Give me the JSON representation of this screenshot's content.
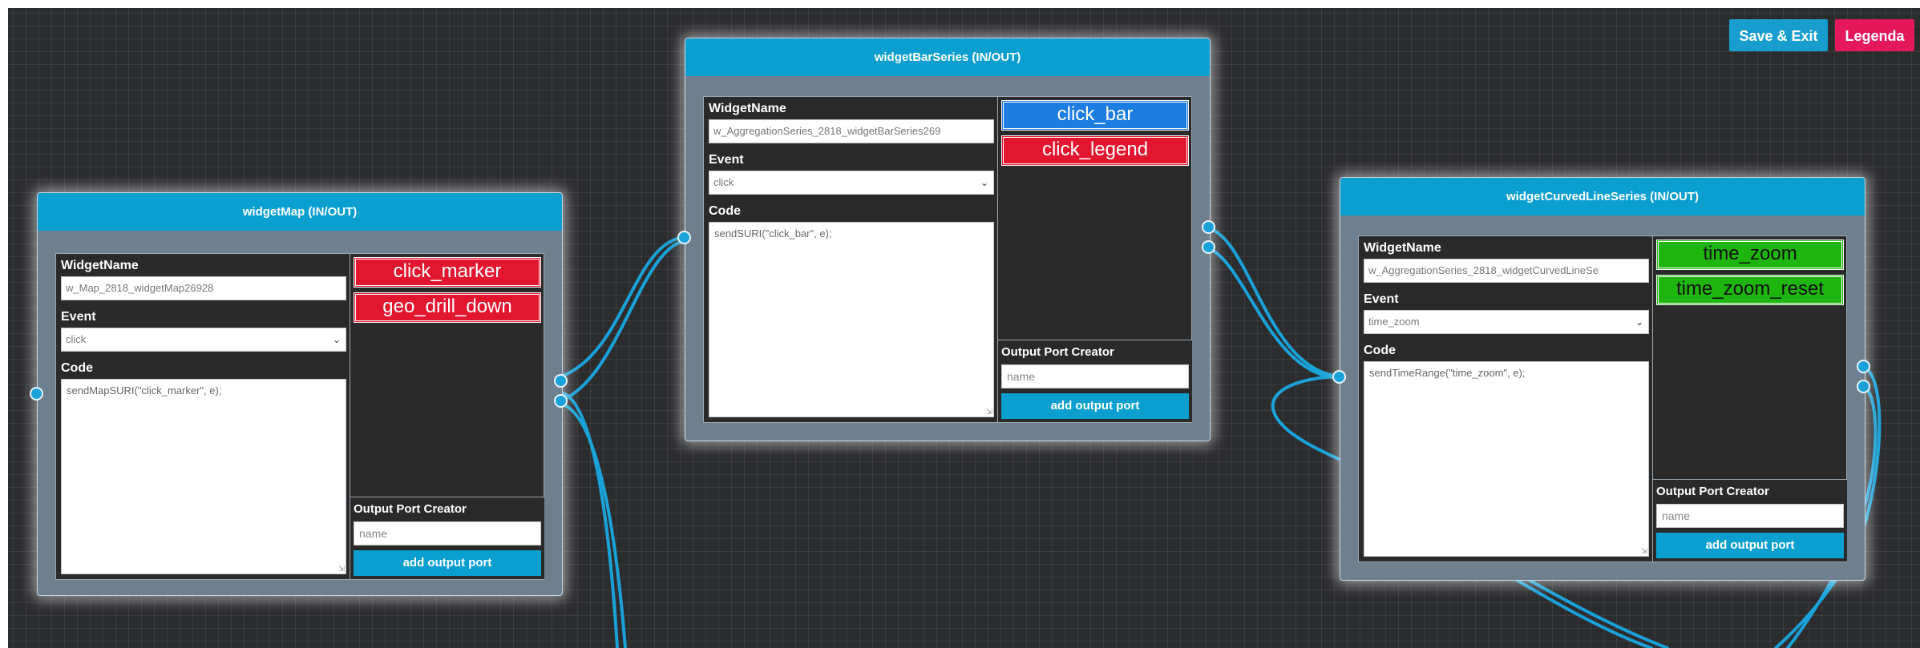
{
  "toolbar": {
    "save_exit": "Save & Exit",
    "legend": "Legenda"
  },
  "colors": {
    "accent": "#0b9fcf",
    "danger": "#e4185a",
    "wire": "#1aa2d8",
    "port_red": "#e2162e",
    "port_blue": "#1d7de0",
    "port_green": "#1fb50f"
  },
  "nodes": [
    {
      "title": "widgetMap (IN/OUT)",
      "widget_name_label": "WidgetName",
      "widget_name_value": "w_Map_2818_widgetMap26928",
      "event_label": "Event",
      "event_value": "click",
      "code_label": "Code",
      "code_value": "sendMapSURI(\"click_marker\", e);",
      "ports": [
        "click_marker",
        "geo_drill_down"
      ],
      "creator_title": "Output Port Creator",
      "creator_placeholder": "name",
      "add_port_label": "add output port"
    },
    {
      "title": "widgetBarSeries (IN/OUT)",
      "widget_name_label": "WidgetName",
      "widget_name_value": "w_AggregationSeries_2818_widgetBarSeries269",
      "event_label": "Event",
      "event_value": "click",
      "code_label": "Code",
      "code_value": "sendSURI(\"click_bar\", e);",
      "ports": [
        "click_bar",
        "click_legend"
      ],
      "creator_title": "Output Port Creator",
      "creator_placeholder": "name",
      "add_port_label": "add output port"
    },
    {
      "title": "widgetCurvedLineSeries (IN/OUT)",
      "widget_name_label": "WidgetName",
      "widget_name_value": "w_AggregationSeries_2818_widgetCurvedLineSe",
      "event_label": "Event",
      "event_value": "time_zoom",
      "code_label": "Code",
      "code_value": "sendTimeRange(\"time_zoom\", e);",
      "ports": [
        "time_zoom",
        "time_zoom_reset"
      ],
      "creator_title": "Output Port Creator",
      "creator_placeholder": "name",
      "add_port_label": "add output port"
    }
  ]
}
